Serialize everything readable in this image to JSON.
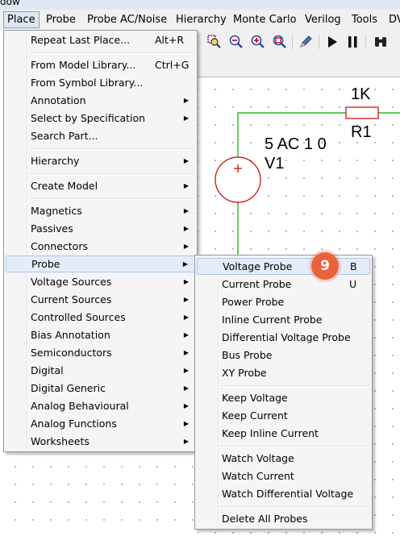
{
  "window": {
    "title_fragment": "dow"
  },
  "menubar": {
    "items": [
      "Place",
      "Probe",
      "Probe AC/Noise",
      "Hierarchy",
      "Monte Carlo",
      "Verilog",
      "Tools",
      "DV"
    ]
  },
  "place_menu": {
    "repeat_last": {
      "label": "Repeat Last Place...",
      "shortcut": "Alt+R"
    },
    "from_model": {
      "label": "From Model Library...",
      "shortcut": "Ctrl+G"
    },
    "from_symbol": {
      "label": "From Symbol Library..."
    },
    "annotation": {
      "label": "Annotation"
    },
    "select_by_spec": {
      "label": "Select by Specification"
    },
    "search_part": {
      "label": "Search Part..."
    },
    "hierarchy": {
      "label": "Hierarchy"
    },
    "create_model": {
      "label": "Create Model"
    },
    "magnetics": {
      "label": "Magnetics"
    },
    "passives": {
      "label": "Passives"
    },
    "connectors": {
      "label": "Connectors"
    },
    "probe": {
      "label": "Probe"
    },
    "voltage_sources": {
      "label": "Voltage Sources"
    },
    "current_sources": {
      "label": "Current Sources"
    },
    "controlled_sources": {
      "label": "Controlled Sources"
    },
    "bias_annotation": {
      "label": "Bias Annotation"
    },
    "semiconductors": {
      "label": "Semiconductors"
    },
    "digital": {
      "label": "Digital"
    },
    "digital_generic": {
      "label": "Digital Generic"
    },
    "analog_behavioural": {
      "label": "Analog Behavioural"
    },
    "analog_functions": {
      "label": "Analog Functions"
    },
    "worksheets": {
      "label": "Worksheets"
    }
  },
  "probe_submenu": {
    "voltage_probe": {
      "label": "Voltage Probe",
      "shortcut": "B"
    },
    "current_probe": {
      "label": "Current Probe",
      "shortcut": "U"
    },
    "power_probe": {
      "label": "Power Probe"
    },
    "inline_current_probe": {
      "label": "Inline Current Probe"
    },
    "differential_voltage_probe": {
      "label": "Differential Voltage Probe"
    },
    "bus_probe": {
      "label": "Bus Probe"
    },
    "xy_probe": {
      "label": "XY Probe"
    },
    "keep_voltage": {
      "label": "Keep Voltage"
    },
    "keep_current": {
      "label": "Keep Current"
    },
    "keep_inline_current": {
      "label": "Keep Inline Current"
    },
    "watch_voltage": {
      "label": "Watch Voltage"
    },
    "watch_current": {
      "label": "Watch Current"
    },
    "watch_differential_voltage": {
      "label": "Watch Differential Voltage"
    },
    "delete_all_probes": {
      "label": "Delete All Probes"
    }
  },
  "step_badge": {
    "number": "9"
  },
  "schematic": {
    "resistor_value": "1K",
    "resistor_ref": "R1",
    "source_value": "5 AC 1 0",
    "source_ref": "V1"
  },
  "colors": {
    "wire": "#00aa00",
    "component": "#cc0000",
    "badge": "#e8623c"
  },
  "icons": [
    "zoom-area-icon",
    "zoom-out-icon",
    "zoom-in-icon",
    "zoom-fit-icon",
    "pencil-icon",
    "run-icon",
    "pause-icon",
    "binoculars-icon"
  ]
}
